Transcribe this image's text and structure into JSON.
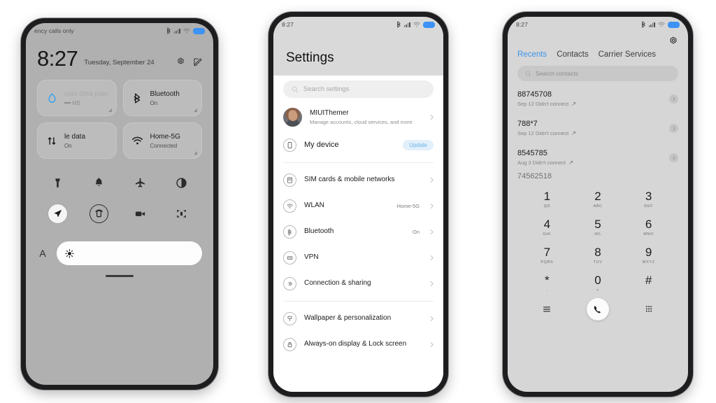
{
  "phones": {
    "control_center": {
      "status": {
        "carrier_text": "ency calls only",
        "icons": [
          "bluetooth-icon",
          "signal-icon",
          "wifi-icon",
          "battery-icon"
        ]
      },
      "clock": {
        "time": "8:27",
        "date": "Tuesday, September 24"
      },
      "header_icons": [
        "settings-gear-icon",
        "edit-icon"
      ],
      "tiles": [
        {
          "icon": "data-drop-icon",
          "title": "own data plan",
          "subtitle": "MB",
          "faded": true
        },
        {
          "icon": "bluetooth-icon",
          "title": "Bluetooth",
          "subtitle": "On",
          "faded": false
        },
        {
          "icon": "mobile-data-icon",
          "title": "le data",
          "subtitle": "On",
          "faded": false
        },
        {
          "icon": "wifi-icon",
          "title": "Home-5G",
          "subtitle": "Connected",
          "faded": false
        }
      ],
      "toggles": [
        {
          "icon": "flashlight-icon",
          "active": false
        },
        {
          "icon": "bell-icon",
          "active": false
        },
        {
          "icon": "airplane-icon",
          "active": false
        },
        {
          "icon": "dark-mode-icon",
          "active": false
        },
        {
          "icon": "location-icon",
          "active": true
        },
        {
          "icon": "auto-rotate-icon",
          "active": true
        },
        {
          "icon": "screen-record-icon",
          "active": false
        },
        {
          "icon": "scan-icon",
          "active": false
        }
      ],
      "brightness": {
        "auto_label": "A",
        "icon": "brightness-sun-icon"
      }
    },
    "settings": {
      "status": {
        "time": "8:27"
      },
      "title": "Settings",
      "search_placeholder": "Search settings",
      "account": {
        "name": "MIUIThemer",
        "subtitle": "Manage accounts, cloud services, and more",
        "avatar": "avatar"
      },
      "device": {
        "label": "My device",
        "badge": "Update",
        "icon": "device-icon"
      },
      "group1": [
        {
          "label": "SIM cards & mobile networks",
          "value": "",
          "icon": "sim-card-icon"
        },
        {
          "label": "WLAN",
          "value": "Home-5G",
          "icon": "wifi-icon"
        },
        {
          "label": "Bluetooth",
          "value": "On",
          "icon": "bluetooth-icon"
        },
        {
          "label": "VPN",
          "value": "",
          "icon": "vpn-icon"
        },
        {
          "label": "Connection & sharing",
          "value": "",
          "icon": "connection-sharing-icon"
        }
      ],
      "group2": [
        {
          "label": "Wallpaper & personalization",
          "value": "",
          "icon": "wallpaper-icon"
        },
        {
          "label": "Always-on display & Lock screen",
          "value": "",
          "icon": "lock-icon"
        }
      ]
    },
    "dialer": {
      "status": {
        "time": "8:27"
      },
      "gear_icon": "settings-gear-icon",
      "tabs": [
        {
          "label": "Recents",
          "active": true
        },
        {
          "label": "Contacts",
          "active": false
        },
        {
          "label": "Carrier Services",
          "active": false
        }
      ],
      "search_placeholder": "Search contacts",
      "recents": [
        {
          "number": "88745708",
          "meta": "Sep 12 Didn't connect"
        },
        {
          "number": "788*7",
          "meta": "Sep 12 Didn't connect"
        },
        {
          "number": "8545785",
          "meta": "Aug 3 Didn't connect"
        },
        {
          "number": "74562518",
          "meta": ""
        }
      ],
      "keypad": [
        {
          "digit": "1",
          "letters": "QD"
        },
        {
          "digit": "2",
          "letters": "ABC"
        },
        {
          "digit": "3",
          "letters": "DEF"
        },
        {
          "digit": "4",
          "letters": "GHI"
        },
        {
          "digit": "5",
          "letters": "JKL"
        },
        {
          "digit": "6",
          "letters": "MNO"
        },
        {
          "digit": "7",
          "letters": "PQRS"
        },
        {
          "digit": "8",
          "letters": "TUV"
        },
        {
          "digit": "9",
          "letters": "WXYZ"
        },
        {
          "digit": "*",
          "letters": ","
        },
        {
          "digit": "0",
          "letters": "+"
        },
        {
          "digit": "#",
          "letters": ""
        }
      ],
      "nav": [
        "menu-icon",
        "call-icon",
        "dialpad-icon"
      ]
    }
  },
  "colors": {
    "accent_blue": "#3b93ed",
    "battery_blue": "#3c92f5",
    "badge_bg": "#e2f0fb",
    "badge_text": "#6ab3e8",
    "frame": "#1d1d1f",
    "cc_bg": "#b0b0b0",
    "settings_header_bg": "#d9d9d9",
    "dialer_bg": "#d6d6d6"
  }
}
